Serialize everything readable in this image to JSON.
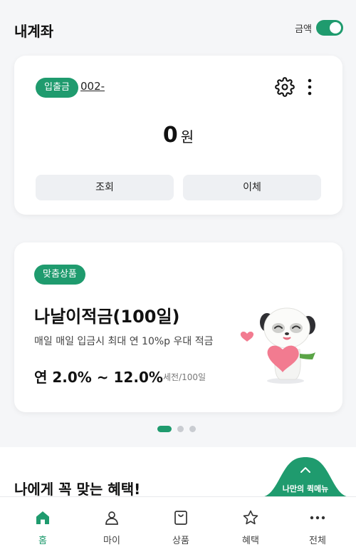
{
  "header": {
    "title": "내계좌",
    "amount_toggle_label": "금액",
    "amount_toggle_on": true
  },
  "account": {
    "badge": "입출금",
    "number": "002-",
    "balance": "0",
    "unit": "원",
    "query_label": "조회",
    "transfer_label": "이체"
  },
  "promo": {
    "badge": "맞춤상품",
    "name": "나날이적금(100일)",
    "description": "매일 매일 입금시 최대 연 10%p 우대 적금",
    "rate": "연 2.0% ~ 12.0%",
    "term": "세전/100일"
  },
  "carousel": {
    "count": 3,
    "active_index": 0
  },
  "section": {
    "title": "나에게 꼭 맞는 혜택!"
  },
  "quickmenu": {
    "label": "나만의 퀵메뉴"
  },
  "nav": {
    "items": [
      {
        "label": "홈",
        "icon": "home-icon",
        "active": true
      },
      {
        "label": "마이",
        "icon": "person-icon",
        "active": false
      },
      {
        "label": "상품",
        "icon": "shopping-bag-icon",
        "active": false
      },
      {
        "label": "혜택",
        "icon": "star-icon",
        "active": false
      },
      {
        "label": "전체",
        "icon": "more-horizontal-icon",
        "active": false
      }
    ]
  },
  "colors": {
    "accent": "#1f9b6e",
    "background": "#f5f6f8",
    "button_bg": "#eef0f3"
  }
}
